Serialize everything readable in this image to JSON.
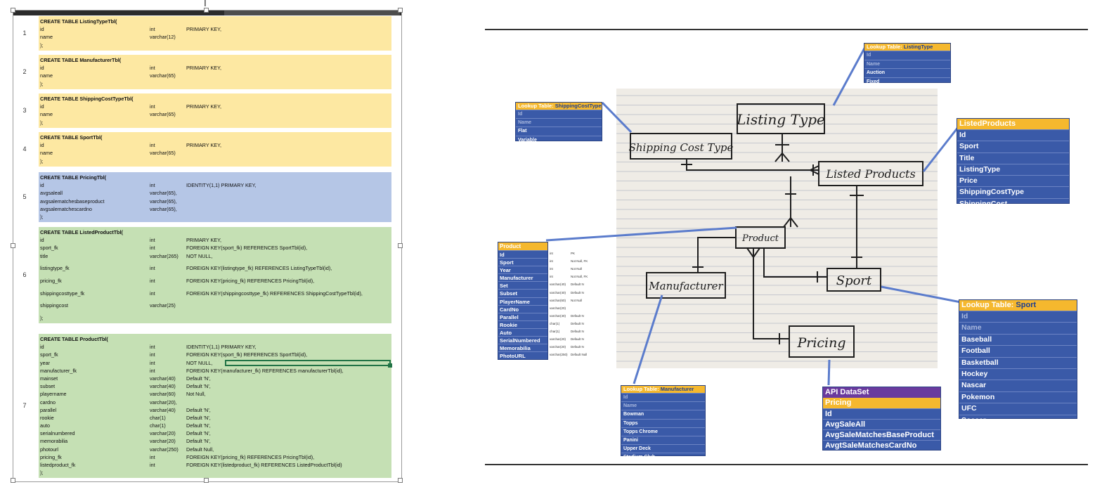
{
  "sheet": {
    "rows": [
      {
        "num": "1",
        "color": "yellow",
        "lines": [
          {
            "c1": "CREATE TABLE ListingTypeTbl(",
            "title": true
          },
          {
            "c1": "id",
            "c2": "int",
            "c3": "PRIMARY KEY,"
          },
          {
            "c1": "name",
            "c2": "varchar(12)"
          },
          {
            "c1": ");"
          }
        ]
      },
      {
        "num": "2",
        "color": "yellow",
        "lines": [
          {
            "c1": "CREATE TABLE ManufacturerTbl(",
            "title": true
          },
          {
            "c1": "id",
            "c2": "int",
            "c3": "PRIMARY KEY,"
          },
          {
            "c1": "name",
            "c2": "varchar(65)"
          },
          {
            "c1": ");"
          }
        ]
      },
      {
        "num": "3",
        "color": "yellow",
        "lines": [
          {
            "c1": "CREATE TABLE ShippingCostTypeTbl(",
            "title": true
          },
          {
            "c1": "id",
            "c2": "int",
            "c3": "PRIMARY KEY,"
          },
          {
            "c1": "name",
            "c2": "varchar(65)"
          },
          {
            "c1": ");"
          }
        ]
      },
      {
        "num": "4",
        "color": "yellow",
        "lines": [
          {
            "c1": "CREATE TABLE SportTbl(",
            "title": true
          },
          {
            "c1": "id",
            "c2": "int",
            "c3": "PRIMARY KEY,"
          },
          {
            "c1": "name",
            "c2": "varchar(65)"
          },
          {
            "c1": ");"
          }
        ]
      },
      {
        "num": "5",
        "color": "blue",
        "lines": [
          {
            "c1": "CREATE TABLE PricingTbl(",
            "title": true
          },
          {
            "c1": "id",
            "c2": "int",
            "c3": "IDENTITY(1,1)  PRIMARY KEY,"
          },
          {
            "c1": "avgsaleall",
            "c2": "varchar(65),"
          },
          {
            "c1": "avgsalematchesbaseproduct",
            "c2": "varchar(65),"
          },
          {
            "c1": "avgsalematchescardno",
            "c2": "varchar(65),"
          },
          {
            "c1": ");"
          }
        ]
      },
      {
        "num": "6",
        "color": "green",
        "lines": [
          {
            "c1": "CREATE TABLE ListedProductTbl(",
            "title": true
          },
          {
            "c1": "id",
            "c2": "int",
            "c3": "PRIMARY KEY,"
          },
          {
            "c1": "sport_fk",
            "c2": "int",
            "c3": "FOREIGN KEY(sport_fk) REFERENCES SportTbl(id),"
          },
          {
            "c1": "title",
            "c2": "varchar(265)",
            "c3": "NOT NULL,"
          },
          {
            "gap": true
          },
          {
            "c1": "listingtype_fk",
            "c2": "int",
            "c3": "FOREIGN KEY(listingtype_fk) REFERENCES ListingTypeTbl(id),"
          },
          {
            "gap": true
          },
          {
            "c1": "pricing_fk",
            "c2": "int",
            "c3": "FOREIGN KEY(pricing_fk) REFERENCES PricingTbl(id),"
          },
          {
            "gap": true
          },
          {
            "c1": "shippingcosttype_fk",
            "c2": "int",
            "c3": "FOREIGN KEY(shippingcosttype_fk) REFERENCES ShippingCostTypeTbl(id),"
          },
          {
            "gap": true
          },
          {
            "c1": "shippingcost",
            "c2": "varchar(25)"
          },
          {
            "gap": true
          },
          {
            "c1": ");"
          }
        ]
      },
      {
        "num": "7",
        "color": "green",
        "lines": [
          {
            "c1": "CREATE TABLE ProductTbl(",
            "title": true
          },
          {
            "c1": "id",
            "c2": "int",
            "c3": "IDENTITY(1,1)  PRIMARY KEY,"
          },
          {
            "c1": "sport_fk",
            "c2": "int",
            "c3": "FOREIGN KEY(sport_fk) REFERENCES SportTbl(id),"
          },
          {
            "c1": "year",
            "c2": "int",
            "c3": "NOT NULL,"
          },
          {
            "c1": "manufacturer_fk",
            "c2": "int",
            "c3": "FOREIGN KEY(manufacturer_fk) REFERENCES manufacturerTbl(id),"
          },
          {
            "c1": "mainset",
            "c2": "varchar(40)",
            "c3": "Default 'N',"
          },
          {
            "c1": "subset",
            "c2": "varchar(40)",
            "c3": "Default 'N',"
          },
          {
            "c1": "playername",
            "c2": "varchar(60)",
            "c3": "Not Null,"
          },
          {
            "c1": "cardno",
            "c2": "varchar(20),"
          },
          {
            "c1": "parallel",
            "c2": "varchar(40)",
            "c3": "Default 'N',"
          },
          {
            "c1": "rookie",
            "c2": "char(1)",
            "c3": "Default 'N',"
          },
          {
            "c1": "auto",
            "c2": "char(1)",
            "c3": "Default 'N',"
          },
          {
            "c1": "serialnumbered",
            "c2": "varchar(20)",
            "c3": "Default 'N',"
          },
          {
            "c1": "memorabilia",
            "c2": "varchar(20)",
            "c3": "Default 'N',"
          },
          {
            "c1": "photourl",
            "c2": "varchar(250)",
            "c3": "Default Null,"
          },
          {
            "c1": "pricing_fk",
            "c2": "int",
            "c3": "FOREIGN KEY(pricing_fk) REFERENCES PricingTbl(id),"
          },
          {
            "c1": "listedproduct_fk",
            "c2": "int",
            "c3": "FOREIGN KEY(listedproduct_fk) REFERENCES ListedProductTbl(id)"
          },
          {
            "c1": ");"
          }
        ]
      }
    ]
  },
  "diagram": {
    "entities": {
      "listing_type": "Listing Type",
      "shipping_cost_type": "Shipping Cost Type",
      "listed_products": "Listed Products",
      "product": "Product",
      "manufacturer": "Manufacturer",
      "sport": "Sport",
      "pricing": "Pricing"
    },
    "lookup_prefix": "Lookup Table:",
    "listing_type_table": {
      "name": "ListingType",
      "rows": [
        "Id",
        "Name",
        "Auction",
        "Fixed"
      ]
    },
    "shipping_table": {
      "name": "ShippingCostType",
      "rows": [
        "Id",
        "Name",
        "Flat",
        "Variable"
      ]
    },
    "listed_products_table": {
      "title": "ListedProducts",
      "rows": [
        "Id",
        "Sport",
        "Title",
        "ListingType",
        "Price",
        "ShippingCostType",
        "ShippingCost"
      ]
    },
    "sport_table": {
      "name": "Sport",
      "rows": [
        "Id",
        "Name",
        "Baseball",
        "Football",
        "Basketball",
        "Hockey",
        "Nascar",
        "Pokemon",
        "UFC",
        "Soccer"
      ]
    },
    "manufacturer_table": {
      "name": "Manufacturer",
      "rows": [
        "Id",
        "Name",
        "Bowman",
        "Topps",
        "Topps Chrome",
        "Panini",
        "Upper Deck",
        "Stadium Club"
      ]
    },
    "api_table": {
      "title": "API DataSet",
      "subtitle": "Pricing",
      "rows": [
        "Id",
        "AvgSaleAll",
        "AvgSaleMatchesBaseProduct",
        "AvgtSaleMatchesCardNo"
      ]
    },
    "product_table": {
      "title": "Product",
      "rows": [
        {
          "name": "Id",
          "type": "int",
          "note": "PK"
        },
        {
          "name": "Sport",
          "type": "int",
          "note": "Not Null, FK"
        },
        {
          "name": "Year",
          "type": "int",
          "note": "Not Null"
        },
        {
          "name": "Manufacturer",
          "type": "int",
          "note": "Not Null, FK"
        },
        {
          "name": "Set",
          "type": "varchar(40)",
          "note": "Default N"
        },
        {
          "name": "Subset",
          "type": "varchar(40)",
          "note": "Default N"
        },
        {
          "name": "PlayerName",
          "type": "varchar(60)",
          "note": "Not Null"
        },
        {
          "name": "CardNo",
          "type": "varchar(20)",
          "note": ""
        },
        {
          "name": "Parallel",
          "type": "varchar(40)",
          "note": "Default N"
        },
        {
          "name": "Rookie",
          "type": "char(1)",
          "note": "Default N"
        },
        {
          "name": "Auto",
          "type": "char(1)",
          "note": "Default N"
        },
        {
          "name": "SerialNumbered",
          "type": "varchar(20)",
          "note": "Default N"
        },
        {
          "name": "Memorabilia",
          "type": "varchar(20)",
          "note": "Default N"
        },
        {
          "name": "PhotoURL",
          "type": "varchar(250)",
          "note": "Default Null"
        }
      ]
    }
  }
}
